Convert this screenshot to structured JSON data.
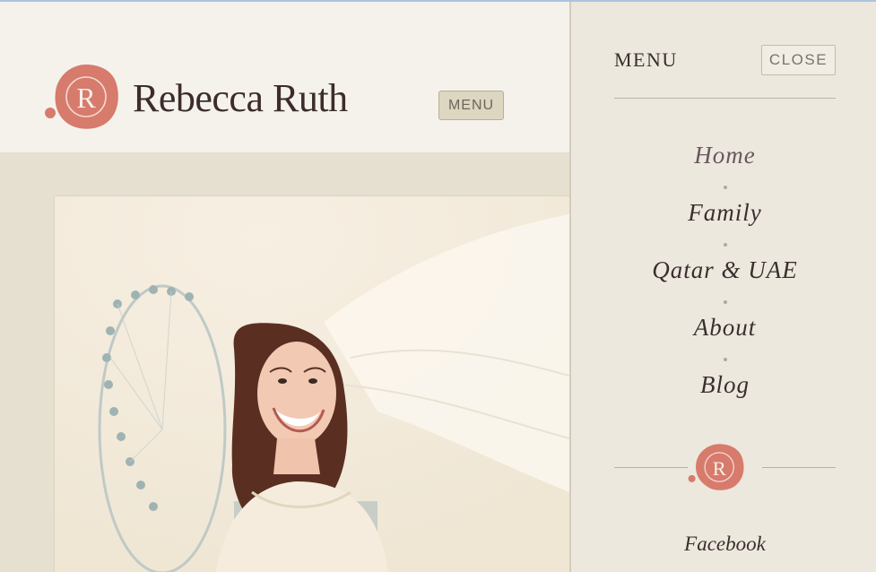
{
  "site": {
    "title": "Rebecca Ruth",
    "logo_letter": "R"
  },
  "header": {
    "menu_button_label": "MENU"
  },
  "panel": {
    "title": "MENU",
    "close_label": "CLOSE",
    "nav_items": [
      {
        "label": "Home",
        "active": true
      },
      {
        "label": "Family",
        "active": false
      },
      {
        "label": "Qatar & UAE",
        "active": false
      },
      {
        "label": "About",
        "active": false
      },
      {
        "label": "Blog",
        "active": false
      }
    ],
    "social": [
      "Facebook"
    ]
  },
  "colors": {
    "brand_coral": "#d77b6c",
    "text_dark": "#3d2c2c",
    "nav_active": "#6b5560",
    "header_bg": "#f5f2ec",
    "page_bg": "#e6e0d0",
    "panel_bg": "#ede8de"
  }
}
